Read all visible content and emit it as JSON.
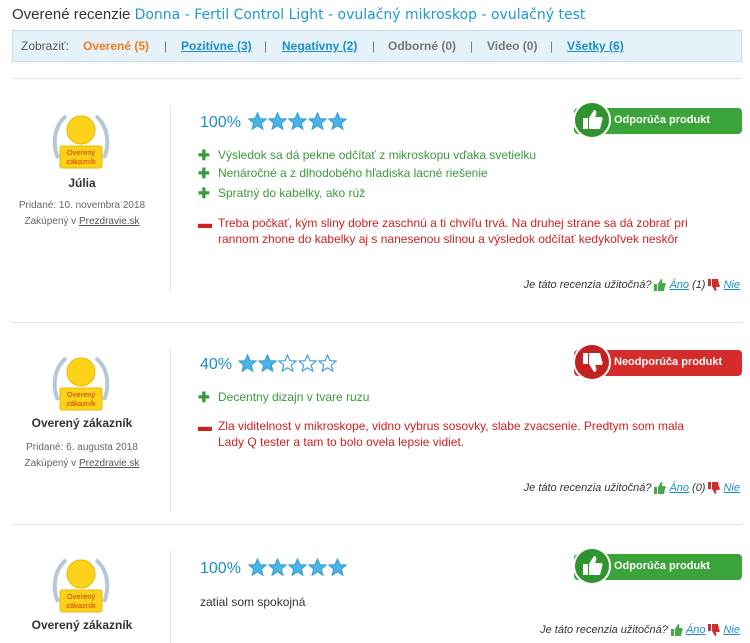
{
  "header": {
    "prefix": "Overené recenzie",
    "product": "Donna - Fertil Control Light - ovulačný mikroskop - ovulačný test"
  },
  "filter": {
    "label": "Zobraziť:",
    "items": [
      {
        "label": "Overené (5)",
        "state": "active"
      },
      {
        "label": "Pozitívne (3)",
        "state": "link"
      },
      {
        "label": "Negatívny (2)",
        "state": "link"
      },
      {
        "label": "Odborné (0)",
        "state": "disabled"
      },
      {
        "label": "Video (0)",
        "state": "disabled"
      },
      {
        "label": "Všetky (6)",
        "state": "link"
      }
    ],
    "separator": "|"
  },
  "colors": {
    "accent": "#1a8fc6",
    "positive": "#3aa33a",
    "negative": "#d52b2b",
    "star": "#4bb4e6"
  },
  "badge_text": "Overený zákazník",
  "reviews": [
    {
      "user": "Júlia",
      "added": "Pridané: 10. novembra 2018",
      "bought_prefix": "Zakúpený v ",
      "shop": "Prezdravie.sk",
      "score": "100%",
      "stars": 5,
      "recommend": "Odporúča produkt",
      "recommend_type": "positive",
      "pros": [
        "Výsledok sa dá pekne odčítať z mikroskopu vďaka svetielku",
        "Nenáročné a z dlhodobého hľadiska lacné riešenie",
        "Spratný do kabelky, ako rúž"
      ],
      "cons": [
        "Treba počkať, kým sliny dobre zaschnú a ti chvíľu trvá. Na druhej strane sa dá zobrať pri rannom zhone do kabelky aj s nanesenou slinou a výsledok odčítať kedykoľvek neskôr"
      ],
      "useful_q": "Je táto recenzia užitočná?",
      "yes": "Áno",
      "yes_count": "(1)",
      "no": "Nie"
    },
    {
      "user": "Overený zákazník",
      "added": "Pridané: 6. augusta 2018",
      "bought_prefix": "Zakúpený v ",
      "shop": "Prezdravie.sk",
      "score": "40%",
      "stars": 2,
      "recommend": "Neodporúča produkt",
      "recommend_type": "negative",
      "pros": [
        "Decentny dizajn v tvare ruzu"
      ],
      "cons": [
        "Zla viditelnost v mikroskope, vidno vybrus sosovky, slabe zvacsenie. Predtym som mala Lady Q tester a tam to bolo ovela lepsie vidiet."
      ],
      "useful_q": "Je táto recenzia užitočná?",
      "yes": "Áno",
      "yes_count": "(0)",
      "no": "Nie"
    },
    {
      "user": "Overený zákazník",
      "score": "100%",
      "stars": 5,
      "recommend": "Odporúča produkt",
      "recommend_type": "positive",
      "text": "zatial som spokojná",
      "useful_q": "Je táto recenzia užitočná?",
      "yes": "Áno",
      "no": "Nie"
    }
  ]
}
